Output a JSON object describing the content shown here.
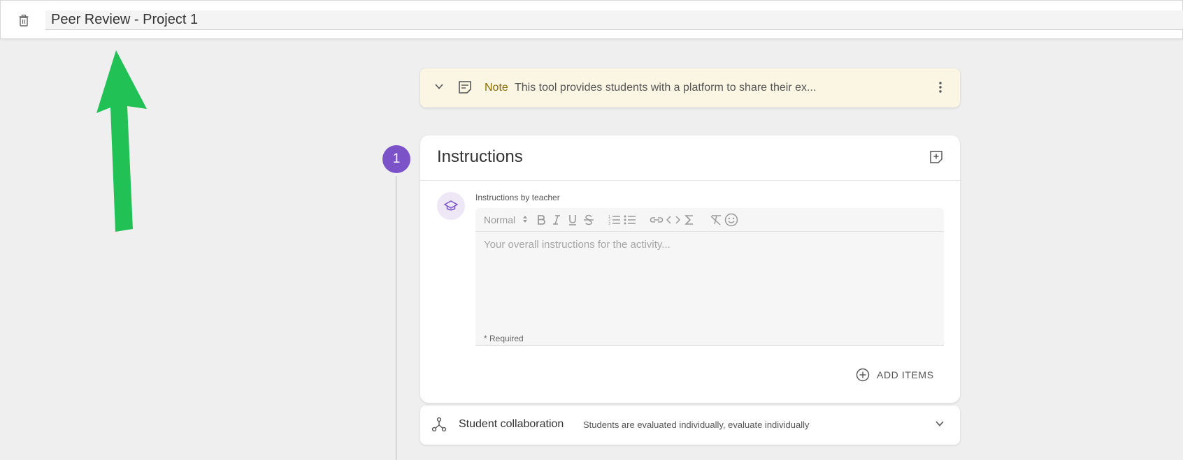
{
  "header": {
    "title_value": "Peer Review - Project 1",
    "delete_icon": "trash-icon"
  },
  "annotation": {
    "arrow_color": "#22c155"
  },
  "note": {
    "label": "Note",
    "text": "This tool provides students with a platform to share their ex...",
    "background": "#fbf5e3"
  },
  "step": {
    "number": "1",
    "color": "#7b52c7"
  },
  "instructions": {
    "title": "Instructions",
    "teacher_label": "Instructions by teacher",
    "editor": {
      "format_select": "Normal",
      "placeholder": "Your overall instructions for the activity...",
      "required": "* Required"
    },
    "add_items_label": "ADD ITEMS"
  },
  "collaboration": {
    "title": "Student collaboration",
    "description": "Students are evaluated individually, evaluate individually"
  }
}
